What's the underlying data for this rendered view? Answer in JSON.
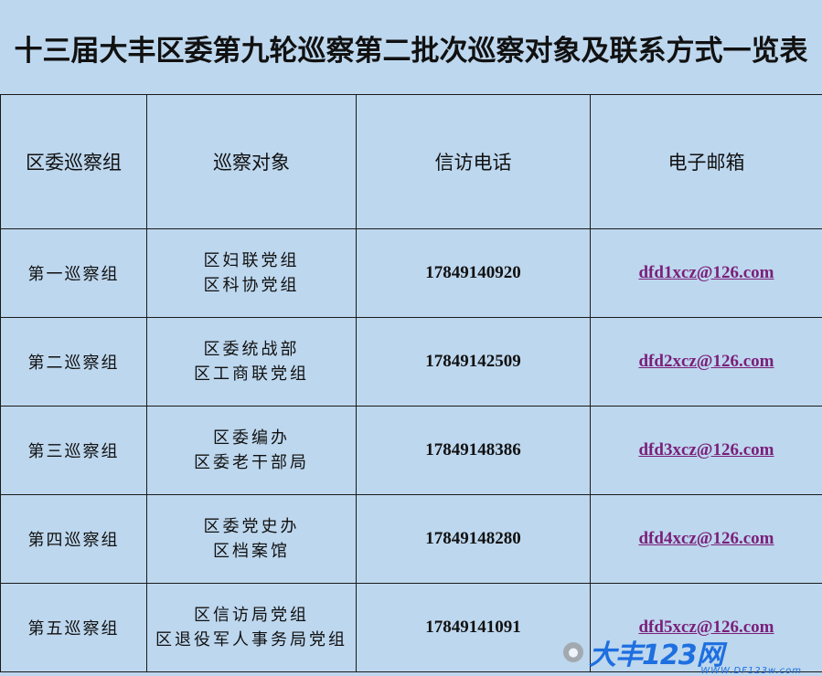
{
  "title": "十三届大丰区委第九轮巡察第二批次巡察对象及联系方式一览表",
  "headers": {
    "group": "区委巡察组",
    "targets": "巡察对象",
    "phone": "信访电话",
    "email": "电子邮箱"
  },
  "rows": [
    {
      "group": "第一巡察组",
      "target1": "区妇联党组",
      "target2": "区科协党组",
      "phone": "17849140920",
      "email": "dfd1xcz@126.com"
    },
    {
      "group": "第二巡察组",
      "target1": "区委统战部",
      "target2": "区工商联党组",
      "phone": "17849142509",
      "email": "dfd2xcz@126.com"
    },
    {
      "group": "第三巡察组",
      "target1": "区委编办",
      "target2": "区委老干部局",
      "phone": "17849148386",
      "email": "dfd3xcz@126.com"
    },
    {
      "group": "第四巡察组",
      "target1": "区委党史办",
      "target2": "区档案馆",
      "phone": "17849148280",
      "email": "dfd4xcz@126.com"
    },
    {
      "group": "第五巡察组",
      "target1": "区信访局党组",
      "target2": "区退役军人事务局党组",
      "phone": "17849141091",
      "email": "dfd5xcz@126.com"
    }
  ],
  "watermark": {
    "logo_text": "大丰123网",
    "url_text": "WWW.DF123w.com",
    "icon": "wechat-icon"
  },
  "colors": {
    "background": "#bdd7ee",
    "email_link": "#7a1f7a",
    "watermark": "#1e6fe0"
  }
}
